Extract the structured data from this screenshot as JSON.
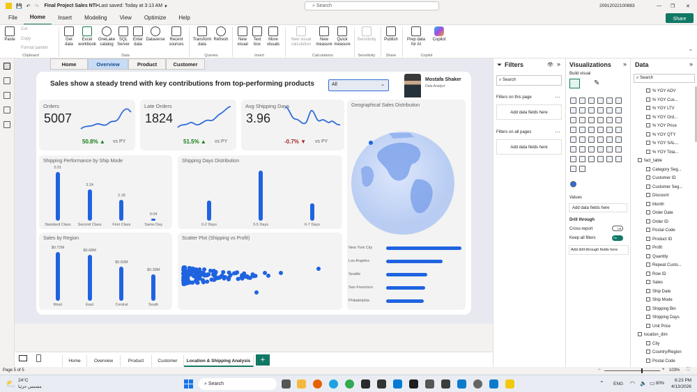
{
  "titlebar": {
    "file": "Final Project Sales NTI",
    "saved": "Last saved: Today at 3:13 AM",
    "search": "Search",
    "user": "20912022100883"
  },
  "menu": [
    "File",
    "Home",
    "Insert",
    "Modeling",
    "View",
    "Optimize",
    "Help"
  ],
  "share": "Share",
  "ribbon": {
    "clipboard": {
      "paste": "Paste",
      "cut": "Cut",
      "copy": "Copy",
      "format_painter": "Format painter",
      "group": "Clipboard"
    },
    "data": {
      "get_data": "Get data",
      "excel": "Excel workbook",
      "onelake": "OneLake catalog",
      "sql": "SQL Server",
      "enter": "Enter data",
      "dataverse": "Dataverse",
      "recent": "Recent sources",
      "group": "Data"
    },
    "queries": {
      "transform": "Transform data",
      "refresh": "Refresh",
      "group": "Queries"
    },
    "insert": {
      "visual": "New visual",
      "textbox": "Text box",
      "more": "More visuals",
      "group": "Insert"
    },
    "calc": {
      "newcalc": "New visual calculation",
      "measure": "New measure",
      "quick": "Quick measure",
      "group": "Calculations"
    },
    "sens": {
      "sensitivity": "Sensitivity",
      "group": "Sensitivity"
    },
    "share": {
      "publish": "Publish",
      "group": "Share"
    },
    "copilot": {
      "prep": "Prep data for AI",
      "copilot": "Copilot",
      "group": "Copilot"
    }
  },
  "report": {
    "nav": [
      "Home",
      "Overview",
      "Product",
      "Customer"
    ],
    "headline": "Sales show a steady trend with key contributions from top-performing products",
    "slicer_value": "All",
    "profile_name": "Mostafa Shaker",
    "profile_role": "Data Analyst",
    "kpis": [
      {
        "title": "Orders",
        "value": "5007",
        "change": "50.8%",
        "arrow": "▲",
        "vs": "vs PY",
        "color": "#107c10"
      },
      {
        "title": "Late Orders",
        "value": "1824",
        "change": "51.5%",
        "arrow": "▲",
        "vs": "vs PY",
        "color": "#107c10"
      },
      {
        "title": "Avg Shipping Days",
        "value": "3.96",
        "change": "-0.7%",
        "arrow": "▼",
        "vs": "vs PY",
        "color": "#a4262c"
      }
    ],
    "ship_mode": {
      "title": "Shipping Performance by Ship Mode"
    },
    "ship_days": {
      "title": "Shipping Days Distribution"
    },
    "region": {
      "title": "Sales by Region"
    },
    "scatter": {
      "title": "Scatter Plot (Shipping vs Profit)"
    },
    "geo": {
      "title": "Geographical Sales Distribution"
    }
  },
  "chart_data": [
    {
      "type": "bar",
      "title": "Shipping Performance by Ship Mode",
      "categories": [
        "Standard Class",
        "Second Class",
        "First Class",
        "Same Day"
      ],
      "values": [
        5.01,
        3.24,
        2.18,
        0.04
      ],
      "value_labels": [
        "5.01",
        "3.24",
        "2.18",
        "0.04"
      ]
    },
    {
      "type": "bar",
      "title": "Shipping Days Distribution",
      "categories": [
        "0-2 Days",
        "3-5 Days",
        "6-7 Days"
      ],
      "values": [
        1300,
        3200,
        1100
      ]
    },
    {
      "type": "bar",
      "title": "Sales by Region",
      "categories": [
        "West",
        "East",
        "Central",
        "South"
      ],
      "values": [
        0.72,
        0.68,
        0.5,
        0.39
      ],
      "value_labels": [
        "$0.72M",
        "$0.68M",
        "$0.50M",
        "$0.39M"
      ]
    },
    {
      "type": "bar",
      "title": "",
      "orientation": "horizontal",
      "categories": [
        "New York City",
        "Los Angeles",
        "Seattle",
        "San Francisco",
        "Philadelphia"
      ],
      "values": [
        100,
        75,
        55,
        52,
        50
      ]
    }
  ],
  "filters": {
    "title": "Filters",
    "search": "Search",
    "on_page": "Filters on this page",
    "add1": "Add data fields here",
    "all_pages": "Filters on all pages",
    "add2": "Add data fields here"
  },
  "viz": {
    "title": "Visualizations",
    "build": "Build visual",
    "values": "Values",
    "add_values": "Add data fields here",
    "drill": "Drill through",
    "cross": "Cross-report",
    "cross_state": "Off",
    "keep": "Keep all filters",
    "keep_state": "On",
    "add_drill": "Add drill-through fields here"
  },
  "data_pane": {
    "title": "Data",
    "search": "Search",
    "items": [
      "% YOY AOV",
      "% YOY Cus...",
      "% YOY LTV",
      "% YOY Ord...",
      "% YOY Price",
      "% YOY QTY",
      "% YOY SAL...",
      "% YOY Tota...",
      "fact_table",
      "Category Seg...",
      "Customer ID",
      "Customer Seg...",
      "Discount",
      "Month",
      "Order Date",
      "Order ID",
      "Postal Code",
      "Product ID",
      "Profit",
      "Quantity",
      "Repeat Custo...",
      "Row ID",
      "Sales",
      "Ship Date",
      "Ship Mode",
      "Shipping Bin",
      "Shipping Days",
      "Unit Price",
      "location_dim",
      "City",
      "Country/Region",
      "Postal Code"
    ]
  },
  "tabs": [
    "Home",
    "Overview",
    "Product",
    "Customer",
    "Location & Shipping Analysis"
  ],
  "status": {
    "page": "Page 5 of 5",
    "zoom": "103%"
  },
  "taskbar": {
    "temp": "24°C",
    "weather": "مشمس جزئيا",
    "search": "Search",
    "lang": "ENG",
    "battery": "80%",
    "time": "6:23 PM",
    "date": "4/13/2026"
  }
}
